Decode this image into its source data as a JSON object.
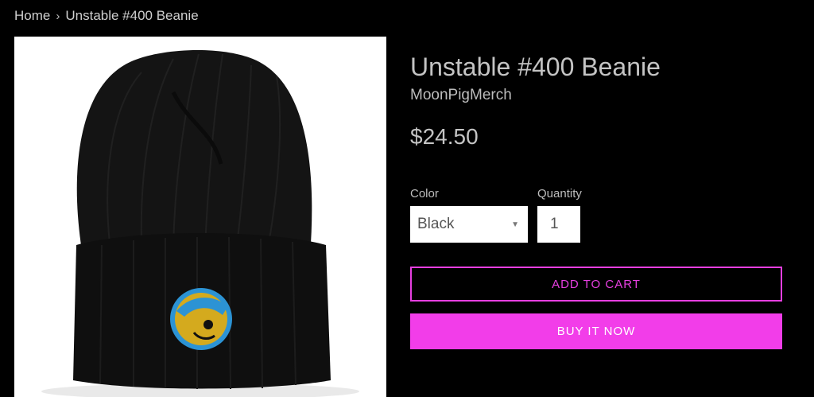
{
  "breadcrumb": {
    "home_label": "Home",
    "separator": "›",
    "current_label": "Unstable #400 Beanie"
  },
  "product": {
    "title": "Unstable #400 Beanie",
    "vendor": "MoonPigMerch",
    "price": "$24.50",
    "image_icon": "beanie-product-photo"
  },
  "options": {
    "color_label": "Color",
    "color_value": "Black",
    "quantity_label": "Quantity",
    "quantity_value": "1"
  },
  "actions": {
    "add_to_cart_label": "ADD TO CART",
    "buy_now_label": "BUY IT NOW"
  },
  "colors": {
    "background": "#000000",
    "accent": "#f23de9",
    "accent_outline": "#e63fe0",
    "text": "#c4c4c4"
  }
}
